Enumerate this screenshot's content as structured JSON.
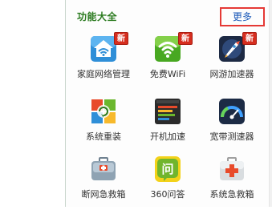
{
  "panel": {
    "title": "功能大全",
    "more_label": "更多"
  },
  "badge_text": "新",
  "items": [
    {
      "label": "家庭网络管理",
      "icon": "home-network-icon",
      "has_badge": true
    },
    {
      "label": "免费WiFi",
      "icon": "wifi-icon",
      "has_badge": true
    },
    {
      "label": "网游加速器",
      "icon": "game-accelerator-icon",
      "has_badge": true
    },
    {
      "label": "系统重装",
      "icon": "system-reinstall-icon",
      "has_badge": false
    },
    {
      "label": "开机加速",
      "icon": "boot-speedup-icon",
      "has_badge": false
    },
    {
      "label": "宽带测速器",
      "icon": "broadband-speedometer-icon",
      "has_badge": false
    },
    {
      "label": "断网急救箱",
      "icon": "network-first-aid-icon",
      "has_badge": false
    },
    {
      "label": "360问答",
      "icon": "qa-icon",
      "has_badge": false
    },
    {
      "label": "系统急救箱",
      "icon": "system-first-aid-icon",
      "has_badge": false
    }
  ],
  "colors": {
    "title_green": "#2a7a1e",
    "more_blue": "#1a58b8",
    "highlight_red": "#e53935",
    "badge_red": "#d62e1f"
  }
}
